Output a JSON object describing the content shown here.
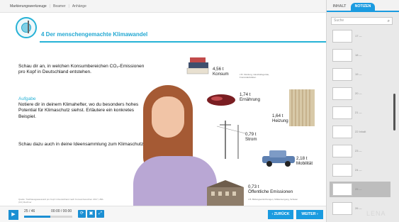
{
  "breadcrumb": {
    "items": [
      "Markierungswerkzeuge",
      "Beamer",
      "Anhänge"
    ]
  },
  "slide": {
    "title": "4 Der menschengemachte Klimawandel",
    "intro": "Schau dir an, in welchen Konsumbereichen CO₂-Emissionen pro Kopf in Deutschland entstehen.",
    "task_heading": "Aufgabe",
    "task_text": "Notiere dir in deinem Klimahefter, wo du besonders hohes Potential für Klimaschutz siehst. Erläutere ein konkretes Beispiel.",
    "extra_text": "Schau dazu auch in deine Ideensammlung zum Klimaschutz.",
    "source": "Quelle: Treibhausgasausstoß pro Kopf in Deutschland nach Konsumbereichen 2017, UBA (CC) Rechner",
    "items": [
      {
        "value": "4,56 t",
        "label": "Konsum",
        "note": "z.B. Kleidung, Haushaltsgeräte, Freizeitaktivitäten"
      },
      {
        "value": "1,74 t",
        "label": "Ernährung"
      },
      {
        "value": "1,64 t",
        "label": "Heizung"
      },
      {
        "value": "0,79 t",
        "label": "Strom"
      },
      {
        "value": "2,18 t",
        "label": "Mobilität"
      },
      {
        "value": "0,73 t",
        "label": "Öffentliche Emissionen",
        "note": "z.B. Bildungseinrichtungen, Müllentsorgung, Schulen"
      }
    ]
  },
  "player": {
    "page": "25 / 46",
    "time": "00:00 / 00:00",
    "progress_fraction": 0.54,
    "play_icon": "▶",
    "back_label": "‹ ZURÜCK",
    "next_label": "WEITER ›"
  },
  "panel": {
    "tab_inhalt": "INHALT",
    "tab_notizen": "NOTIZEN",
    "search_placeholder": "Suche",
    "thumbs": [
      {
        "label": "17 —"
      },
      {
        "label": "18 —"
      },
      {
        "label": "19 —"
      },
      {
        "label": "20 —"
      },
      {
        "label": "21 —"
      },
      {
        "label": "22 Inhalt"
      },
      {
        "label": "23 —"
      },
      {
        "label": "24 —"
      },
      {
        "label": "25 —"
      },
      {
        "label": "26 —"
      }
    ],
    "watermark": "LENA"
  },
  "colors": {
    "accent": "#1b9be0",
    "title": "#22a8d2",
    "selected_thumb": "#bdbdbd"
  }
}
